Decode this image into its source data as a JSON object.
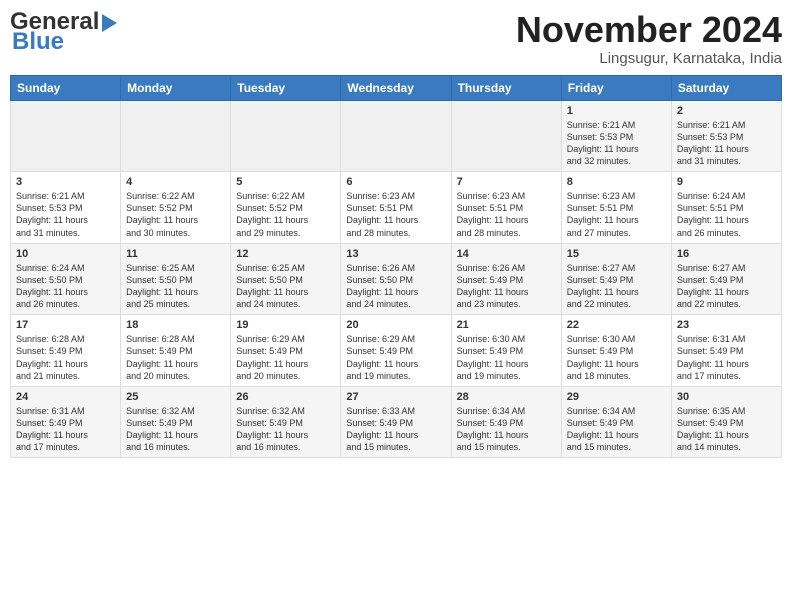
{
  "header": {
    "logo_general": "General",
    "logo_blue": "Blue",
    "month_title": "November 2024",
    "location": "Lingsugur, Karnataka, India"
  },
  "weekdays": [
    "Sunday",
    "Monday",
    "Tuesday",
    "Wednesday",
    "Thursday",
    "Friday",
    "Saturday"
  ],
  "weeks": [
    [
      {
        "day": "",
        "info": ""
      },
      {
        "day": "",
        "info": ""
      },
      {
        "day": "",
        "info": ""
      },
      {
        "day": "",
        "info": ""
      },
      {
        "day": "",
        "info": ""
      },
      {
        "day": "1",
        "info": "Sunrise: 6:21 AM\nSunset: 5:53 PM\nDaylight: 11 hours\nand 32 minutes."
      },
      {
        "day": "2",
        "info": "Sunrise: 6:21 AM\nSunset: 5:53 PM\nDaylight: 11 hours\nand 31 minutes."
      }
    ],
    [
      {
        "day": "3",
        "info": "Sunrise: 6:21 AM\nSunset: 5:53 PM\nDaylight: 11 hours\nand 31 minutes."
      },
      {
        "day": "4",
        "info": "Sunrise: 6:22 AM\nSunset: 5:52 PM\nDaylight: 11 hours\nand 30 minutes."
      },
      {
        "day": "5",
        "info": "Sunrise: 6:22 AM\nSunset: 5:52 PM\nDaylight: 11 hours\nand 29 minutes."
      },
      {
        "day": "6",
        "info": "Sunrise: 6:23 AM\nSunset: 5:51 PM\nDaylight: 11 hours\nand 28 minutes."
      },
      {
        "day": "7",
        "info": "Sunrise: 6:23 AM\nSunset: 5:51 PM\nDaylight: 11 hours\nand 28 minutes."
      },
      {
        "day": "8",
        "info": "Sunrise: 6:23 AM\nSunset: 5:51 PM\nDaylight: 11 hours\nand 27 minutes."
      },
      {
        "day": "9",
        "info": "Sunrise: 6:24 AM\nSunset: 5:51 PM\nDaylight: 11 hours\nand 26 minutes."
      }
    ],
    [
      {
        "day": "10",
        "info": "Sunrise: 6:24 AM\nSunset: 5:50 PM\nDaylight: 11 hours\nand 26 minutes."
      },
      {
        "day": "11",
        "info": "Sunrise: 6:25 AM\nSunset: 5:50 PM\nDaylight: 11 hours\nand 25 minutes."
      },
      {
        "day": "12",
        "info": "Sunrise: 6:25 AM\nSunset: 5:50 PM\nDaylight: 11 hours\nand 24 minutes."
      },
      {
        "day": "13",
        "info": "Sunrise: 6:26 AM\nSunset: 5:50 PM\nDaylight: 11 hours\nand 24 minutes."
      },
      {
        "day": "14",
        "info": "Sunrise: 6:26 AM\nSunset: 5:49 PM\nDaylight: 11 hours\nand 23 minutes."
      },
      {
        "day": "15",
        "info": "Sunrise: 6:27 AM\nSunset: 5:49 PM\nDaylight: 11 hours\nand 22 minutes."
      },
      {
        "day": "16",
        "info": "Sunrise: 6:27 AM\nSunset: 5:49 PM\nDaylight: 11 hours\nand 22 minutes."
      }
    ],
    [
      {
        "day": "17",
        "info": "Sunrise: 6:28 AM\nSunset: 5:49 PM\nDaylight: 11 hours\nand 21 minutes."
      },
      {
        "day": "18",
        "info": "Sunrise: 6:28 AM\nSunset: 5:49 PM\nDaylight: 11 hours\nand 20 minutes."
      },
      {
        "day": "19",
        "info": "Sunrise: 6:29 AM\nSunset: 5:49 PM\nDaylight: 11 hours\nand 20 minutes."
      },
      {
        "day": "20",
        "info": "Sunrise: 6:29 AM\nSunset: 5:49 PM\nDaylight: 11 hours\nand 19 minutes."
      },
      {
        "day": "21",
        "info": "Sunrise: 6:30 AM\nSunset: 5:49 PM\nDaylight: 11 hours\nand 19 minutes."
      },
      {
        "day": "22",
        "info": "Sunrise: 6:30 AM\nSunset: 5:49 PM\nDaylight: 11 hours\nand 18 minutes."
      },
      {
        "day": "23",
        "info": "Sunrise: 6:31 AM\nSunset: 5:49 PM\nDaylight: 11 hours\nand 17 minutes."
      }
    ],
    [
      {
        "day": "24",
        "info": "Sunrise: 6:31 AM\nSunset: 5:49 PM\nDaylight: 11 hours\nand 17 minutes."
      },
      {
        "day": "25",
        "info": "Sunrise: 6:32 AM\nSunset: 5:49 PM\nDaylight: 11 hours\nand 16 minutes."
      },
      {
        "day": "26",
        "info": "Sunrise: 6:32 AM\nSunset: 5:49 PM\nDaylight: 11 hours\nand 16 minutes."
      },
      {
        "day": "27",
        "info": "Sunrise: 6:33 AM\nSunset: 5:49 PM\nDaylight: 11 hours\nand 15 minutes."
      },
      {
        "day": "28",
        "info": "Sunrise: 6:34 AM\nSunset: 5:49 PM\nDaylight: 11 hours\nand 15 minutes."
      },
      {
        "day": "29",
        "info": "Sunrise: 6:34 AM\nSunset: 5:49 PM\nDaylight: 11 hours\nand 15 minutes."
      },
      {
        "day": "30",
        "info": "Sunrise: 6:35 AM\nSunset: 5:49 PM\nDaylight: 11 hours\nand 14 minutes."
      }
    ]
  ]
}
